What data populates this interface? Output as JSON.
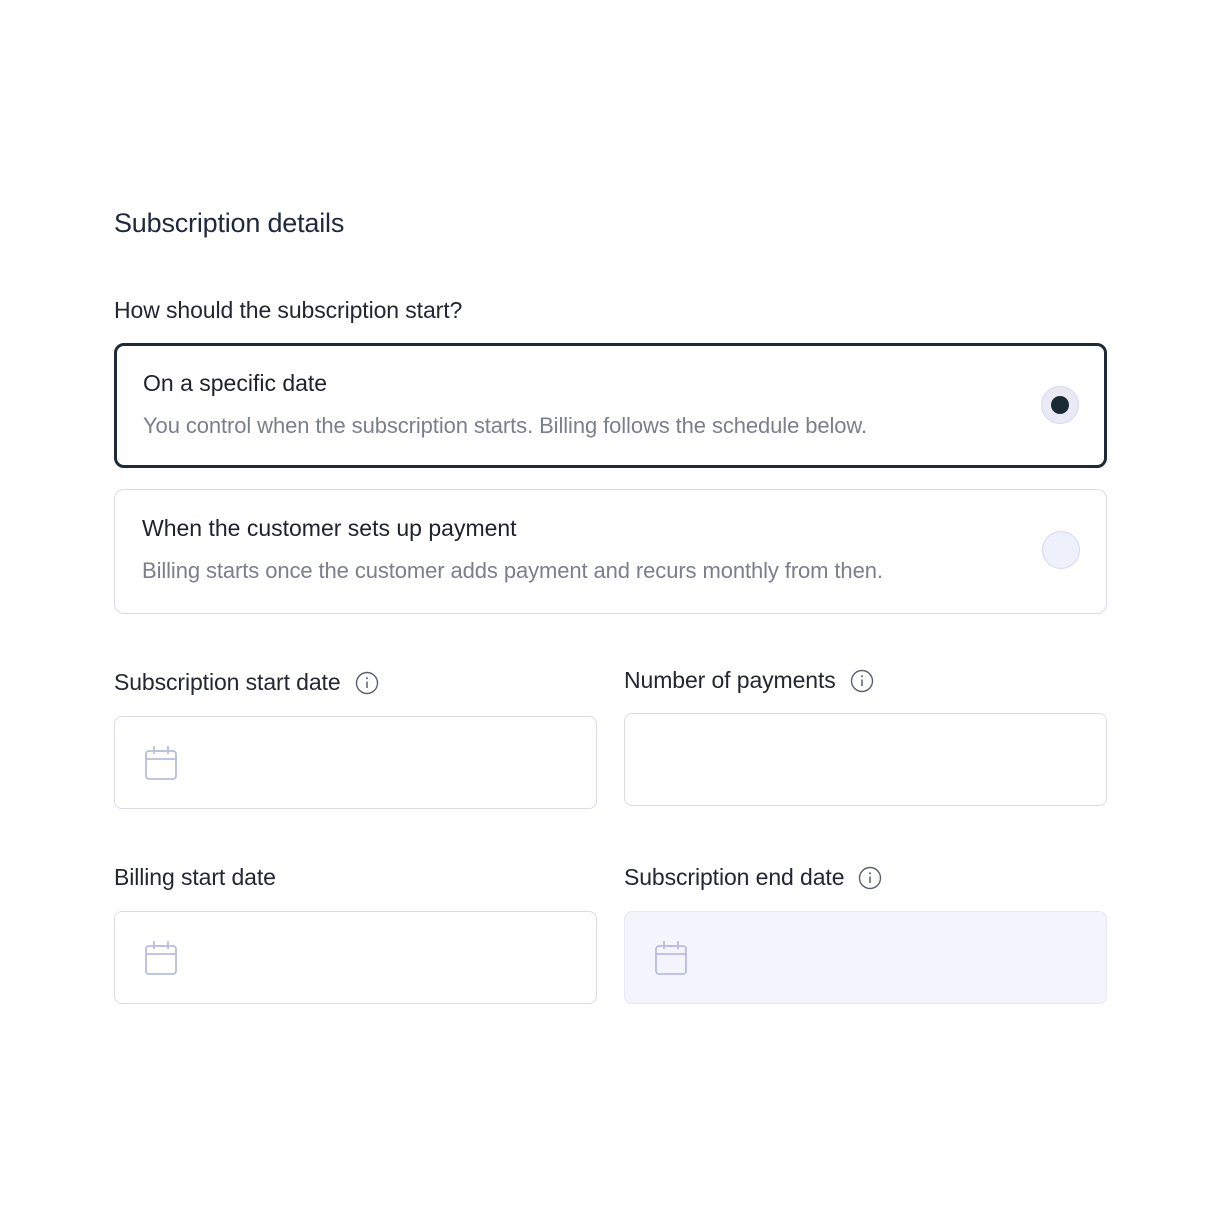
{
  "form": {
    "section_title": "Subscription details",
    "question": "How should the subscription start?",
    "options": [
      {
        "title": "On a specific date",
        "description": "You control when the subscription starts. Billing follows the schedule below.",
        "selected": true
      },
      {
        "title": "When the customer sets up payment",
        "description": "Billing starts once the customer adds payment and recurs monthly from then.",
        "selected": false
      }
    ],
    "fields": {
      "subscription_start_date": {
        "label": "Subscription start date",
        "value": "",
        "icon": "calendar-icon",
        "has_info": true
      },
      "number_of_payments": {
        "label": "Number of payments",
        "value": "",
        "has_info": true
      },
      "billing_start_date": {
        "label": "Billing start date",
        "value": "",
        "icon": "calendar-icon",
        "has_info": false
      },
      "subscription_end_date": {
        "label": "Subscription end date",
        "value": "",
        "icon": "calendar-icon",
        "has_info": true,
        "disabled": true
      }
    }
  },
  "colors": {
    "selected_border": "#1f2a37",
    "default_border": "#d9dbea",
    "radio_dot": "#1b2b33",
    "radio_fill": "#eef0fb",
    "disabled_input_bg": "#f4f5fc",
    "icon_stroke": "#b9bddc"
  }
}
